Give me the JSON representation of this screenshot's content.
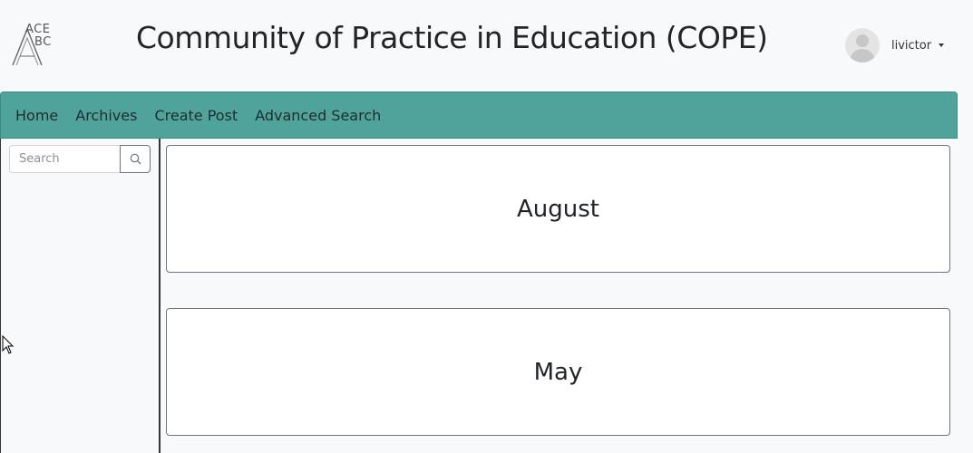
{
  "header": {
    "logo_line1": "ACE",
    "logo_line2": "BC",
    "title": "Community of Practice in Education (COPE)",
    "user": {
      "name": "livictor",
      "avatar_icon": "user-avatar-icon",
      "menu_icon": "caret-down-icon"
    }
  },
  "nav": {
    "links": [
      "Home",
      "Archives",
      "Create Post",
      "Advanced Search"
    ],
    "background": "#4fa39b"
  },
  "sidebar": {
    "search": {
      "placeholder": "Search",
      "value": "",
      "button_icon": "search-icon"
    }
  },
  "archive_cards": [
    "August",
    "May"
  ]
}
